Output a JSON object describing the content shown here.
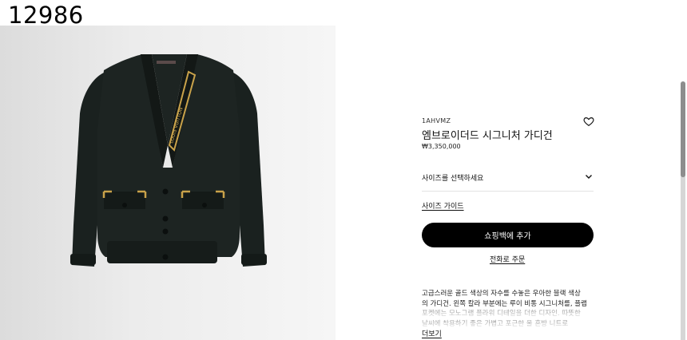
{
  "screenshot_id": "12986",
  "product": {
    "sku": "1AHVMZ",
    "name": "엠브로이더드 시그니처 가디건",
    "price": "₩3,350,000",
    "image_alt": "Black knit cardigan with gold embroidery",
    "collar_text": "LOUIS VUITTON"
  },
  "actions": {
    "size_select_label": "사이즈를 선택하세요",
    "size_guide_label": "사이즈 가이드",
    "add_to_bag_label": "쇼핑백에 추가",
    "order_by_phone_label": "전화로 주문"
  },
  "description": {
    "lines": [
      "고급스러운 골드 색상의 자수를 수놓은 우아한 블랙 색상",
      "의 가디건. 왼쪽 칼라 부분에는 루이 비통 시그니처를, 플랩",
      "포켓에는 모노그램 플라워 디테일을 더한 디자인. 따뜻한",
      "날씨에 착용하기 좋은 가볍고 포근한 울 혼방 니트로"
    ],
    "more_label": "더보기"
  },
  "icons": {
    "wishlist": "heart-icon",
    "size_dropdown": "chevron-down-icon"
  },
  "colors": {
    "button_bg": "#000000",
    "button_text": "#ffffff",
    "cardigan": "#1c2321",
    "embroidery_gold": "#c9a24a"
  }
}
